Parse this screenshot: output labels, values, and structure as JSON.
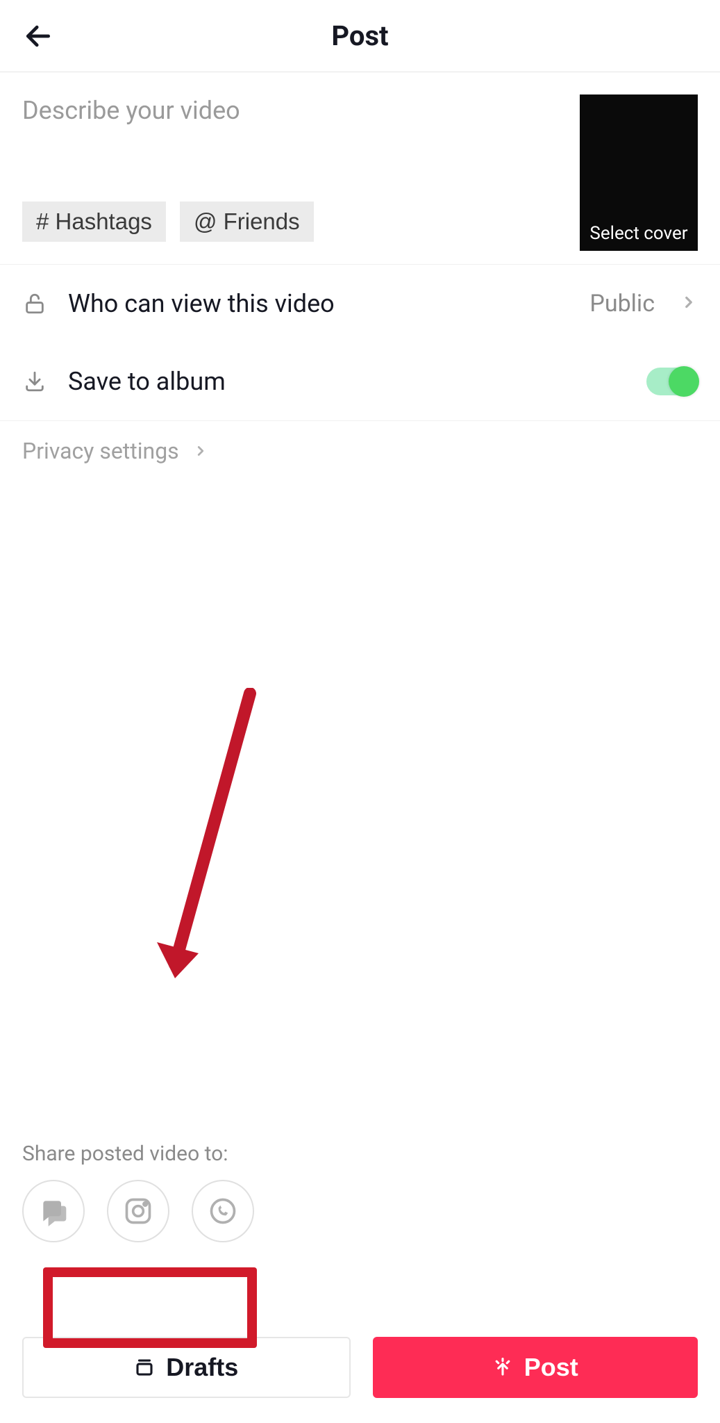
{
  "header": {
    "title": "Post"
  },
  "compose": {
    "placeholder": "Describe your video",
    "hashtags_label": "# Hashtags",
    "friends_label": "@ Friends",
    "cover_label": "Select cover"
  },
  "privacy_row": {
    "label": "Who can view this video",
    "value": "Public"
  },
  "save_row": {
    "label": "Save to album",
    "enabled": true
  },
  "privacy_settings": {
    "label": "Privacy settings"
  },
  "share": {
    "label": "Share posted video to:",
    "targets": [
      "messages",
      "instagram",
      "whatsapp"
    ]
  },
  "bottom": {
    "drafts_label": "Drafts",
    "post_label": "Post"
  }
}
